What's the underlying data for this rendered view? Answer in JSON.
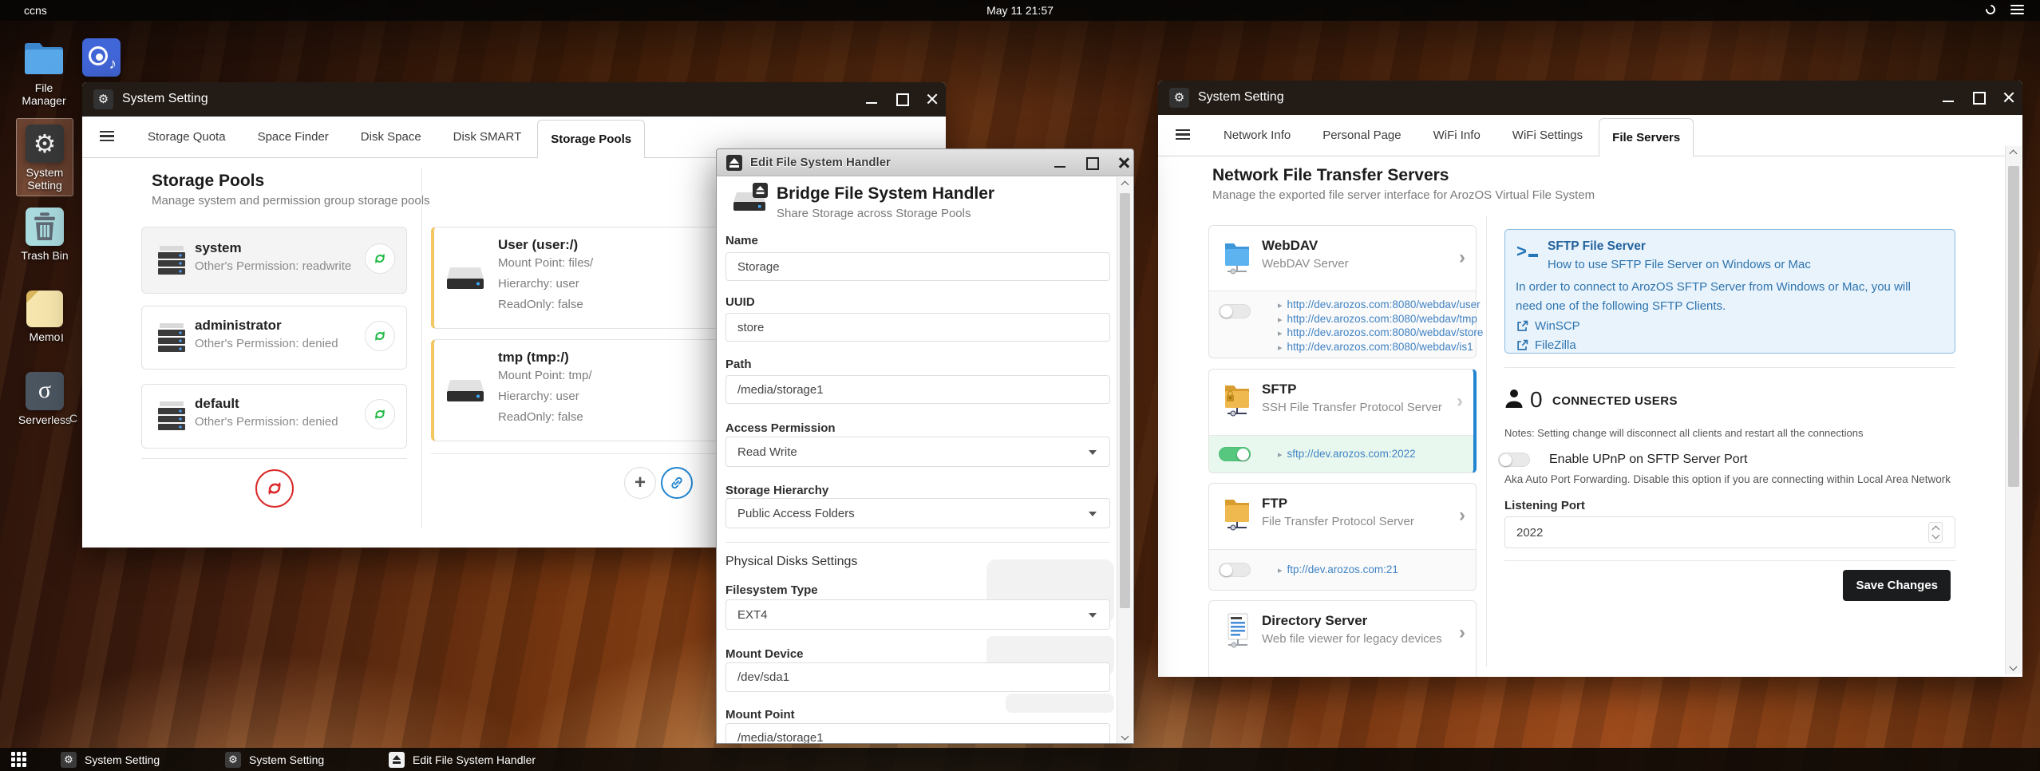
{
  "colors": {
    "accent_blue": "#2185d0",
    "link_blue": "#4183c4",
    "green": "#21ba45",
    "red": "#db2828",
    "yellow_border": "#f2c661",
    "save_button_bg": "#1b1c1d",
    "info_bg": "#e9f3fc",
    "info_border": "#8dbbde",
    "info_text": "#2e74ae"
  },
  "icons": {
    "gear": "⚙",
    "sigma": "σ",
    "note": "♪",
    "chevron_right": "›",
    "bullet": "▸",
    "plus": "+"
  },
  "topbar": {
    "host": "ccns",
    "clock": "May 11 21:57"
  },
  "desktop": {
    "icons": [
      {
        "label": "File Manager"
      },
      {
        "label": ""
      },
      {
        "label": "System Setting"
      },
      {
        "label": "Trash Bin"
      },
      {
        "label": "Memo"
      },
      {
        "label": "Serverless"
      }
    ],
    "fragments": [
      "I",
      "C"
    ]
  },
  "win1": {
    "title": "System Setting",
    "tabs": [
      {
        "label": "Storage Quota"
      },
      {
        "label": "Space Finder"
      },
      {
        "label": "Disk Space"
      },
      {
        "label": "Disk SMART"
      },
      {
        "label": "Storage Pools"
      }
    ],
    "heading": "Storage Pools",
    "subheading": "Manage system and permission group storage pools",
    "pools": [
      {
        "name": "system",
        "desc": "Other's Permission: readwrite"
      },
      {
        "name": "administrator",
        "desc": "Other's Permission: denied"
      },
      {
        "name": "default",
        "desc": "Other's Permission: denied"
      }
    ],
    "mounts": [
      {
        "name": "User (user:/)",
        "lines": [
          "Mount Point: files/",
          "Hierarchy: user",
          "ReadOnly: false"
        ]
      },
      {
        "name": "tmp (tmp:/)",
        "lines": [
          "Mount Point: tmp/",
          "Hierarchy: user",
          "ReadOnly: false"
        ]
      }
    ]
  },
  "dialog": {
    "title": "Edit File System Handler",
    "heading": "Bridge File System Handler",
    "subheading": "Share Storage across Storage Pools",
    "name": {
      "label": "Name",
      "value": "Storage"
    },
    "uuid": {
      "label": "UUID",
      "value": "store"
    },
    "path": {
      "label": "Path",
      "value": "/media/storage1"
    },
    "access_permission": {
      "label": "Access Permission",
      "value": "Read Write"
    },
    "storage_hierarchy": {
      "label": "Storage Hierarchy",
      "value": "Public Access Folders"
    },
    "section": "Physical Disks Settings",
    "filesystem_type": {
      "label": "Filesystem Type",
      "value": "EXT4"
    },
    "mount_device": {
      "label": "Mount Device",
      "value": "/dev/sda1"
    },
    "mount_point": {
      "label": "Mount Point",
      "value": "/media/storage1"
    }
  },
  "win2": {
    "title": "System Setting",
    "tabs": [
      {
        "label": "Network Info"
      },
      {
        "label": "Personal Page"
      },
      {
        "label": "WiFi Info"
      },
      {
        "label": "WiFi Settings"
      },
      {
        "label": "File Servers"
      }
    ],
    "heading": "Network File Transfer Servers",
    "subheading": "Manage the exported file server interface for ArozOS Virtual File System",
    "servers": [
      {
        "name": "WebDAV",
        "desc": "WebDAV Server",
        "links": [
          "http://dev.arozos.com:8080/webdav/user",
          "http://dev.arozos.com:8080/webdav/tmp",
          "http://dev.arozos.com:8080/webdav/store",
          "http://dev.arozos.com:8080/webdav/is1"
        ]
      },
      {
        "name": "SFTP",
        "desc": "SSH File Transfer Protocol Server",
        "links": [
          "sftp://dev.arozos.com:2022"
        ]
      },
      {
        "name": "FTP",
        "desc": "File Transfer Protocol Server",
        "links": [
          "ftp://dev.arozos.com:21"
        ]
      },
      {
        "name": "Directory Server",
        "desc": "Web file viewer for legacy devices",
        "links": []
      }
    ],
    "sftp_info": {
      "title": "SFTP File Server",
      "subtitle": "How to use SFTP File Server on Windows or Mac",
      "body": "In order to connect to ArozOS SFTP Server from Windows or Mac, you will need one of the following SFTP Clients.",
      "clients": [
        "WinSCP",
        "FileZilla"
      ]
    },
    "connected": {
      "count": "0",
      "label": "CONNECTED USERS",
      "notes": "Notes: Setting change will disconnect all clients and restart all the connections"
    },
    "upnp": {
      "label": "Enable UPnP on SFTP Server Port",
      "desc": "Aka Auto Port Forwarding. Disable this option if you are connecting within Local Area Network"
    },
    "listening_port": {
      "label": "Listening Port",
      "value": "2022"
    },
    "save_button": "Save Changes"
  },
  "taskbar": {
    "items": [
      {
        "label": "System Setting"
      },
      {
        "label": "System Setting"
      },
      {
        "label": "Edit File System Handler"
      }
    ]
  }
}
